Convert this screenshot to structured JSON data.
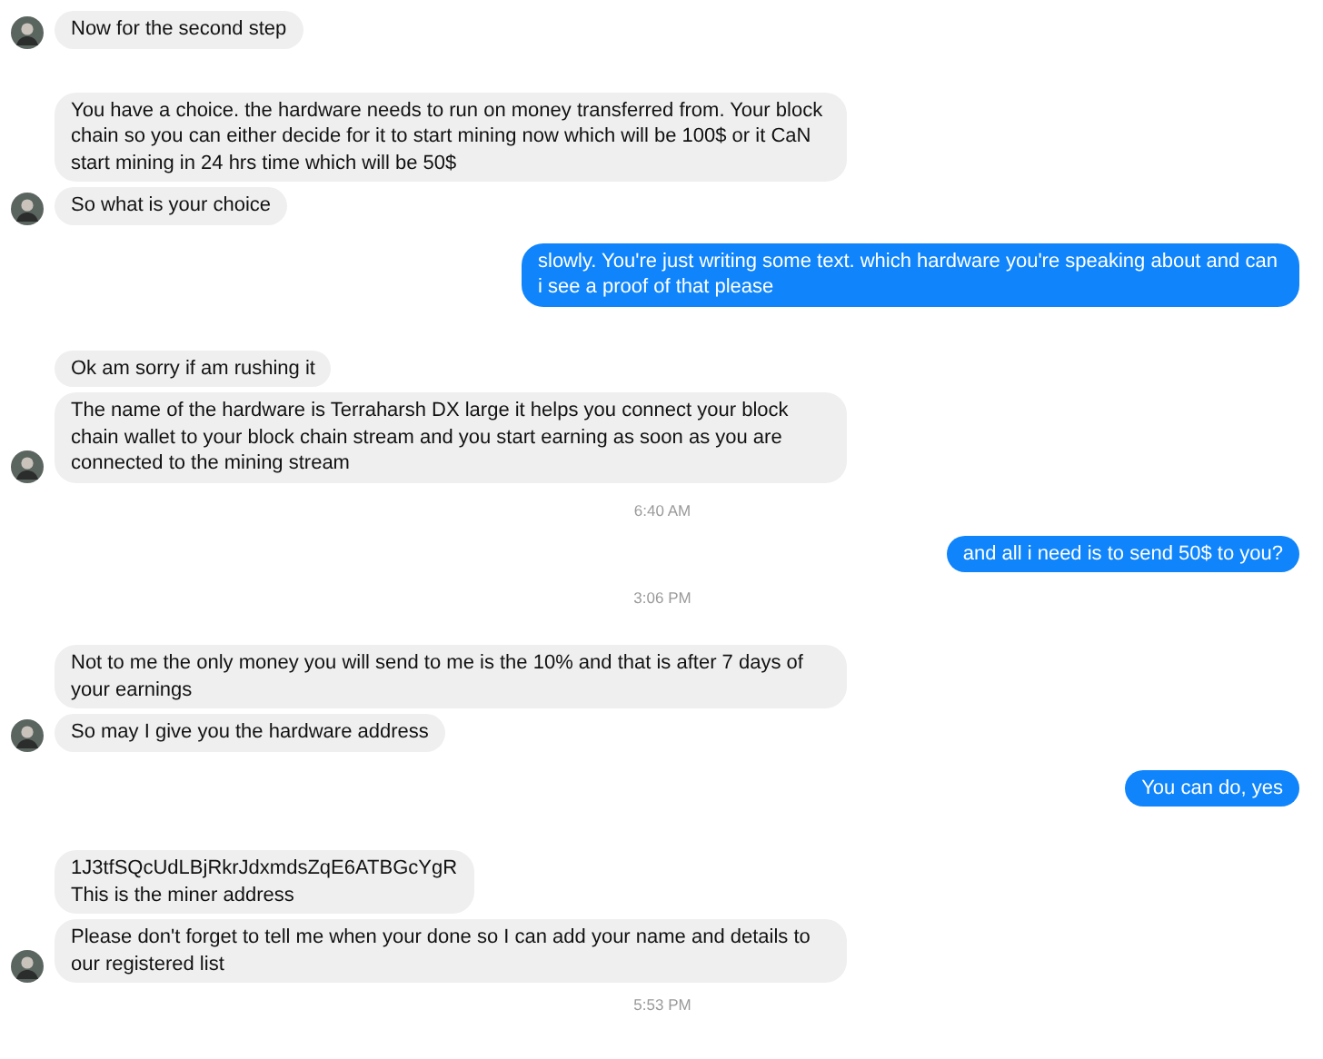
{
  "conversation": [
    {
      "kind": "incoming",
      "messages": [
        "Now for the second step"
      ]
    },
    {
      "kind": "incoming",
      "messages": [
        "You have a choice. the hardware needs to run on money transferred from. Your block chain so you can either decide for it to start mining now which will be 100$ or it CaN start mining in 24 hrs time which will be 50$",
        "So what is your choice"
      ]
    },
    {
      "kind": "outgoing",
      "messages": [
        "slowly. You're just writing some text. which hardware you're speaking about and can i see a proof of that please"
      ]
    },
    {
      "kind": "incoming",
      "messages": [
        "Ok am sorry if am rushing it",
        "The name of the hardware is Terraharsh DX large it helps you connect your block chain wallet to your block chain stream and you start earning as soon as you are connected to the mining stream"
      ]
    },
    {
      "kind": "timestamp",
      "text": "6:40 AM"
    },
    {
      "kind": "outgoing",
      "messages": [
        "and all i need is to send 50$ to you?"
      ]
    },
    {
      "kind": "timestamp",
      "text": "3:06 PM"
    },
    {
      "kind": "incoming",
      "messages": [
        "Not to me the only money you will send to me is the 10% and that is after 7 days of your earnings",
        "So may I give you the hardware address"
      ]
    },
    {
      "kind": "outgoing",
      "messages": [
        "You can do, yes"
      ]
    },
    {
      "kind": "incoming",
      "messages": [
        "1J3tfSQcUdLBjRkrJdxmdsZqE6ATBGcYgR\nThis is the miner address",
        "Please don't forget to tell me when your done so I can add your name and details to our registered list"
      ]
    },
    {
      "kind": "timestamp",
      "text": "5:53 PM"
    }
  ]
}
